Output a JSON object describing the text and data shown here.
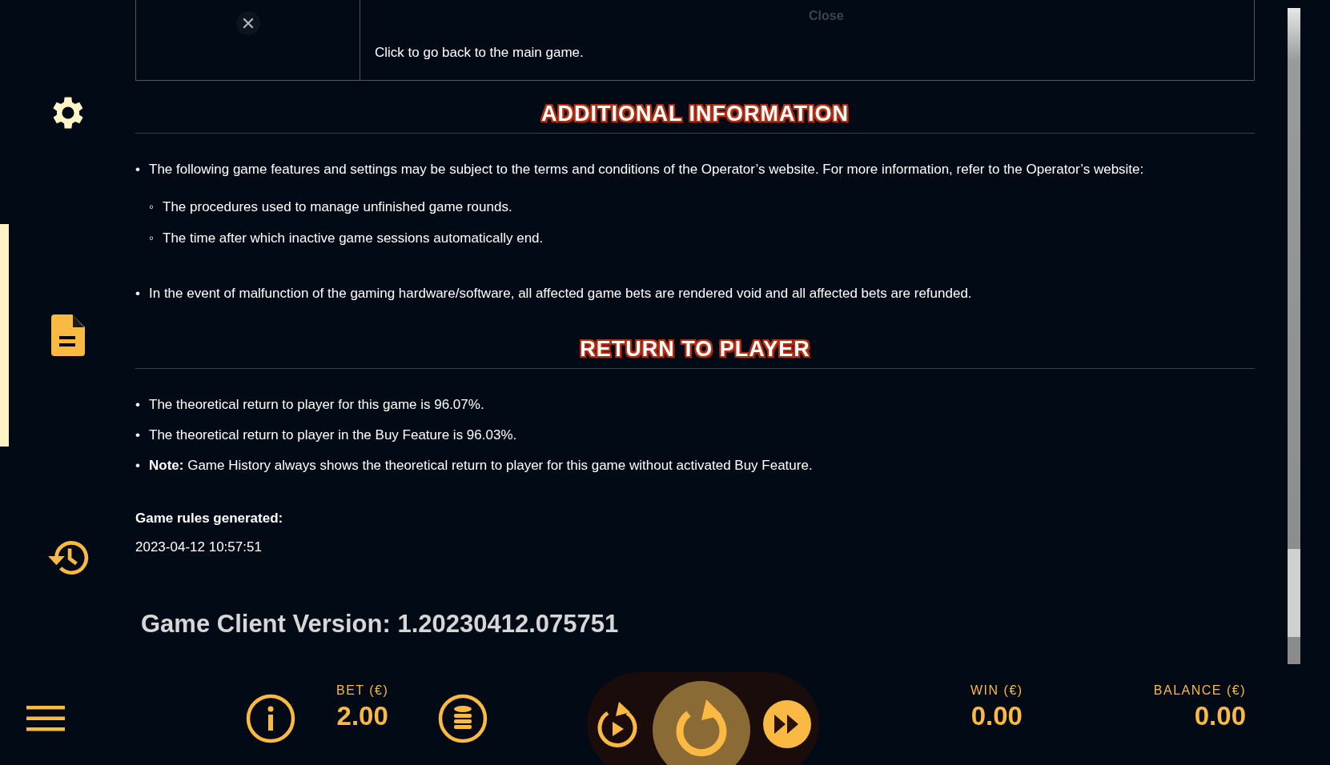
{
  "close_row": {
    "header": "Close",
    "description": "Click to go back to the main game."
  },
  "sidebar": {
    "items": [
      {
        "kind": "settings",
        "selected": false
      },
      {
        "kind": "rules",
        "selected": true
      },
      {
        "kind": "history",
        "selected": false
      }
    ]
  },
  "sections": [
    {
      "title": "ADDITIONAL INFORMATION",
      "bullets": [
        {
          "marker": "•",
          "text": "The following game features and settings may be subject to the terms and conditions of the Operator’s website. For more information, refer to the Operator’s website:",
          "children": [
            {
              "marker": "◦",
              "text": "The procedures used to manage unfinished game rounds."
            },
            {
              "marker": "◦",
              "text": "The time after which inactive game sessions automatically end."
            }
          ]
        },
        {
          "marker": "•",
          "text": "In the event of malfunction of the gaming hardware/software, all affected game bets are rendered void and all affected bets are refunded."
        }
      ]
    },
    {
      "title": "RETURN TO PLAYER",
      "bullets": [
        {
          "marker": "•",
          "text": "The theoretical return to player for this game is 96.07%."
        },
        {
          "marker": "•",
          "text": "The theoretical return to player in the Buy Feature is 96.03%."
        },
        {
          "marker": "•",
          "text": "**Note:** Game History always shows the theoretical return to player for this game without activated Buy Feature."
        }
      ]
    }
  ],
  "generated": {
    "label": "Game rules generated:",
    "value": "2023-04-12 10:57:51"
  },
  "version": "Game Client Version: 1.20230412.075751",
  "bottom_bar": {
    "bet": {
      "label": "BET (€)",
      "value": "2.00"
    },
    "win": {
      "label": "WIN (€)",
      "value": "0.00"
    },
    "balance": {
      "label": "BALANCE (€)",
      "value": "0.00"
    }
  }
}
